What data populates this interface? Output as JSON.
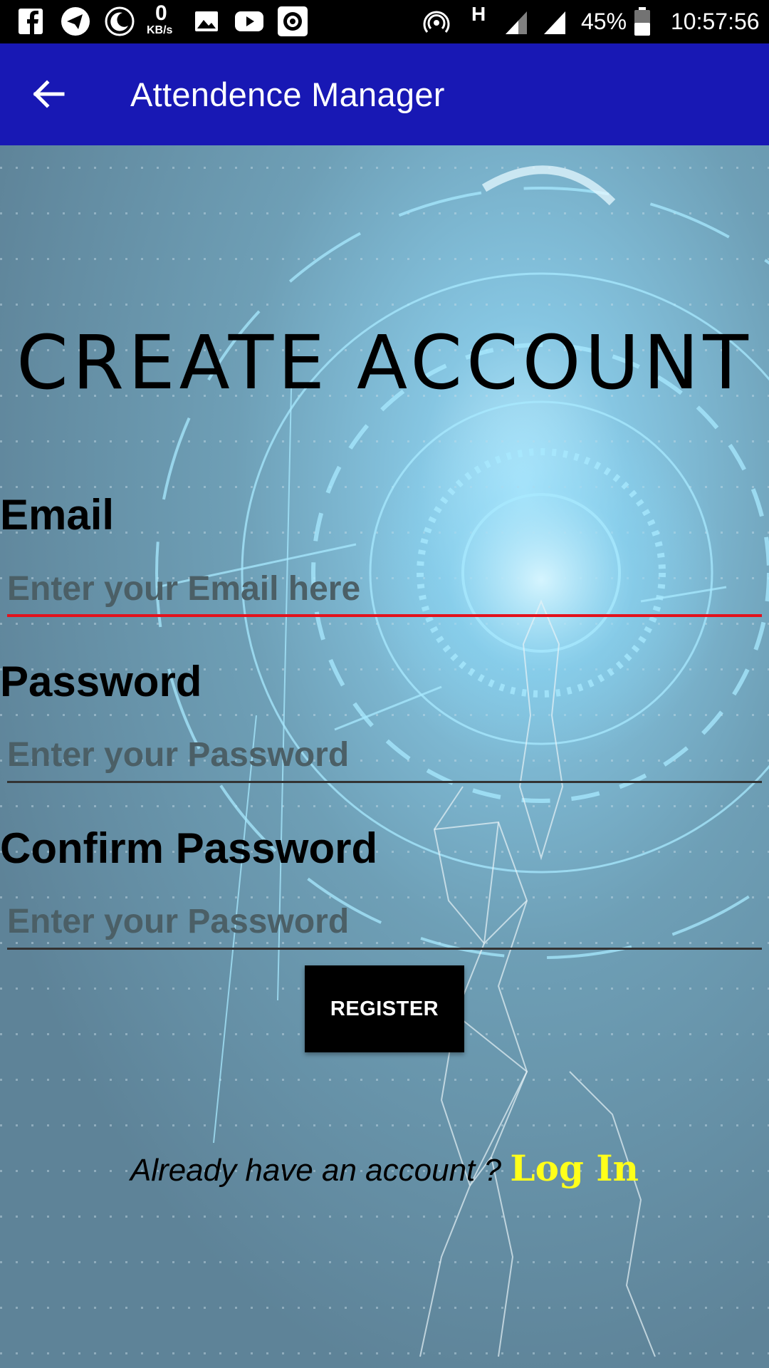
{
  "status_bar": {
    "icons": [
      "facebook-icon",
      "telegram-icon",
      "moon-icon",
      "image-icon",
      "youtube-icon",
      "record-icon",
      "hotspot-icon",
      "signal-icon",
      "signal-icon",
      "battery-icon"
    ],
    "net_speed_value": "0",
    "net_speed_unit": "KB/s",
    "network_type": "H",
    "battery_percent": "45%",
    "time": "10:57:56"
  },
  "app_bar": {
    "back_icon": "arrow-left-icon",
    "title": "Attendence Manager",
    "color": "#1818b4"
  },
  "form": {
    "heading": "CREATE ACCOUNT",
    "email": {
      "label": "Email",
      "placeholder": "Enter your Email here",
      "value": ""
    },
    "password": {
      "label": "Password",
      "placeholder": "Enter your Password",
      "value": ""
    },
    "confirm_password": {
      "label": "Confirm Password",
      "placeholder": "Enter your Password",
      "value": ""
    },
    "register_label": "REGISTER",
    "login_prompt": "Already have an account ?",
    "login_link": "Log In"
  },
  "colors": {
    "focused_underline": "#e3121d",
    "login_link": "#ffff1a",
    "button_bg": "#000000"
  }
}
